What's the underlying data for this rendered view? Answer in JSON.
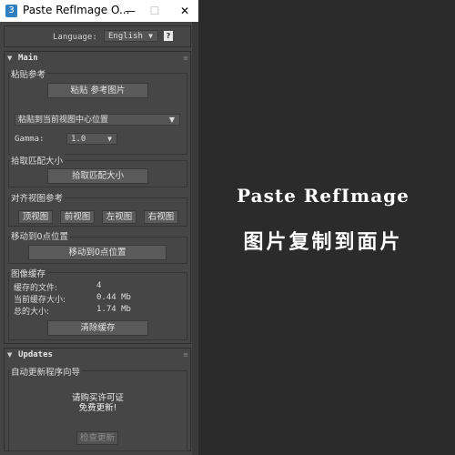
{
  "window": {
    "title": "Paste RefImage O...",
    "app_icon": "3",
    "minimize": "—",
    "maximize": "☐",
    "close": "✕"
  },
  "language": {
    "label": "Language:",
    "value": "English",
    "help": "?"
  },
  "main_rollout": {
    "title": "Main",
    "paste_group": {
      "label": "粘贴参考",
      "paste_button": "粘贴 参考图片",
      "position_dropdown": "粘贴到当前视图中心位置",
      "gamma_label": "Gamma:",
      "gamma_value": "1.0"
    },
    "match_group": {
      "label": "拾取匹配大小",
      "button": "拾取匹配大小"
    },
    "align_group": {
      "label": "对齐视图参考",
      "buttons": [
        "顶视图",
        "前视图",
        "左视图",
        "右视图"
      ]
    },
    "origin_group": {
      "label": "移动到0点位置",
      "button": "移动到0点位置"
    },
    "cache_group": {
      "label": "图像缓存",
      "rows": [
        {
          "key": "缓存的文件:",
          "value": "4"
        },
        {
          "key": "当前缓存大小:",
          "value": "0.44 Mb"
        },
        {
          "key": "总的大小:",
          "value": "1.74 Mb"
        }
      ],
      "clear_button": "清除缓存"
    }
  },
  "updates_rollout": {
    "title": "Updates",
    "group_label": "自动更新程序向导",
    "message_line1": "请购买许可证",
    "message_line2": "免费更新!",
    "check_button": "检查更新"
  },
  "hero": {
    "english": "Paste RefImage",
    "chinese": "图片复制到面片"
  },
  "colors": {
    "background": "#2b2b2b",
    "panel": "#444444",
    "text": "#dedede"
  }
}
